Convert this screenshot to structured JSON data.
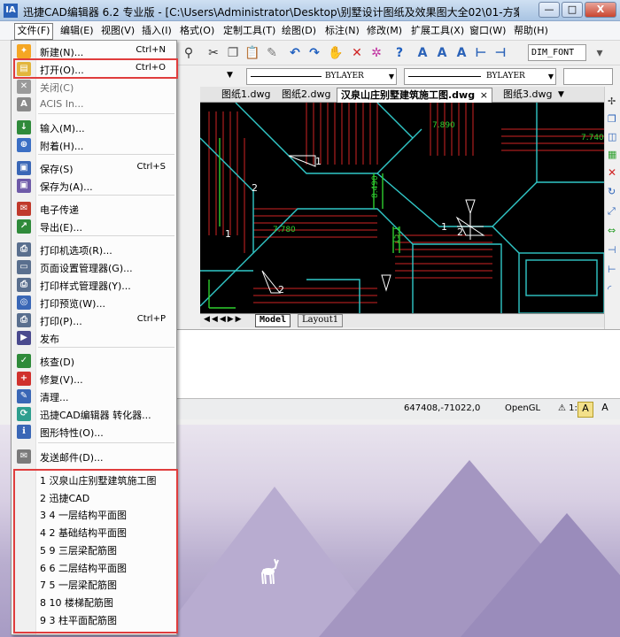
{
  "window": {
    "title": "迅捷CAD编辑器 6.2 专业版 - [C:\\Users\\Administrator\\Desktop\\别墅设计图纸及效果图大全02\\01-方案及施工图\\汉泉...",
    "logo": "IA",
    "minimize": "—",
    "maximize": "□",
    "close": "X"
  },
  "menubar": {
    "items": [
      "文件(F)",
      "编辑(E)",
      "视图(V)",
      "插入(I)",
      "格式(O)",
      "定制工具(T)",
      "绘图(D)",
      "标注(N)",
      "修改(M)",
      "扩展工具(X)",
      "窗口(W)",
      "帮助(H)"
    ]
  },
  "toolbar": {
    "dim_font": "DIM_FONT",
    "linetype": "BYLAYER",
    "lineweight": "BYLAYER"
  },
  "drawing_tabs": [
    "图纸1.dwg",
    "图纸2.dwg",
    "汉泉山庄别墅建筑施工图.dwg",
    "图纸3.dwg"
  ],
  "active_tab_close": "×",
  "layout_tabs": {
    "model": "Model",
    "layout1": "Layout1"
  },
  "status": {
    "coords": "647408,-71022,0",
    "render": "OpenGL",
    "scale": "1:1"
  },
  "file_menu": {
    "items": [
      {
        "label": "新建(N)...",
        "shortcut": "Ctrl+N",
        "icon": "new-file-icon",
        "color": "#f5a623",
        "disabled": false
      },
      {
        "label": "打开(O)...",
        "shortcut": "Ctrl+O",
        "icon": "open-folder-icon",
        "color": "#e2b53d",
        "disabled": false
      },
      {
        "label": "关闭(C)",
        "shortcut": "",
        "icon": "close-doc-icon",
        "color": "#9a9a9a",
        "disabled": true
      },
      {
        "label": "ACIS In...",
        "shortcut": "",
        "icon": "acis-icon",
        "color": "#8a8a8a",
        "disabled": true
      },
      {
        "label": "输入(M)...",
        "shortcut": "",
        "icon": "import-icon",
        "color": "#2f8a3a",
        "disabled": false
      },
      {
        "label": "附着(H)...",
        "shortcut": "",
        "icon": "attach-icon",
        "color": "#3b6fc4",
        "disabled": false
      },
      {
        "label": "保存(S)",
        "shortcut": "Ctrl+S",
        "icon": "save-icon",
        "color": "#3a67b6",
        "disabled": false
      },
      {
        "label": "保存为(A)...",
        "shortcut": "",
        "icon": "save-as-icon",
        "color": "#6e5aa8",
        "disabled": false
      },
      {
        "label": "电子传递",
        "shortcut": "",
        "icon": "etransmit-icon",
        "color": "#c0392b",
        "disabled": false
      },
      {
        "label": "导出(E)...",
        "shortcut": "",
        "icon": "export-icon",
        "color": "#2f8a3a",
        "disabled": false
      },
      {
        "label": "打印机选项(R)...",
        "shortcut": "",
        "icon": "printer-options-icon",
        "color": "#5a6f8e",
        "disabled": false
      },
      {
        "label": "页面设置管理器(G)...",
        "shortcut": "",
        "icon": "page-setup-icon",
        "color": "#5a6f8e",
        "disabled": false
      },
      {
        "label": "打印样式管理器(Y)...",
        "shortcut": "",
        "icon": "plot-style-icon",
        "color": "#5a6f8e",
        "disabled": false
      },
      {
        "label": "打印预览(W)...",
        "shortcut": "",
        "icon": "print-preview-icon",
        "color": "#3a67b6",
        "disabled": false
      },
      {
        "label": "打印(P)...",
        "shortcut": "Ctrl+P",
        "icon": "print-icon",
        "color": "#5a6f8e",
        "disabled": false
      },
      {
        "label": "发布",
        "shortcut": "",
        "icon": "publish-icon",
        "color": "#4a4a8e",
        "disabled": false
      },
      {
        "label": "核查(D)",
        "shortcut": "",
        "icon": "audit-icon",
        "color": "#2f8a3a",
        "disabled": false
      },
      {
        "label": "修复(V)...",
        "shortcut": "",
        "icon": "recover-icon",
        "color": "#d0312d",
        "disabled": false
      },
      {
        "label": "清理...",
        "shortcut": "",
        "icon": "purge-icon",
        "color": "#3a67b6",
        "disabled": false
      },
      {
        "label": "迅捷CAD编辑器 转化器...",
        "shortcut": "",
        "icon": "converter-icon",
        "color": "#2e9e8e",
        "disabled": false
      },
      {
        "label": "图形特性(O)...",
        "shortcut": "",
        "icon": "drawing-properties-icon",
        "color": "#3a67b6",
        "disabled": false
      },
      {
        "label": "发送邮件(D)...",
        "shortcut": "",
        "icon": "send-mail-icon",
        "color": "#7a7a7a",
        "disabled": false
      }
    ],
    "recent": [
      "1 汉泉山庄别墅建筑施工图",
      "2 迅捷CAD",
      "3 4 一层结构平面图",
      "4 2 基础结构平面图",
      "5 9 三层梁配筋图",
      "6 6 二层结构平面图",
      "7 5 一层梁配筋图",
      "8 10 楼梯配筋图",
      "9 3 柱平面配筋图"
    ]
  },
  "drawing_labels": {
    "a": "1",
    "b": "2",
    "c": "1",
    "d": "2",
    "e": "1",
    "f": "2",
    "g": "7.890",
    "h": "7.740",
    "i": "7.780",
    "j": "8.490",
    "k": "15.1",
    "l": "1"
  },
  "colors": {
    "highlight": "#e03d3d",
    "canvas": "#000000",
    "line_red": "#d02424",
    "line_cyan": "#31c8c8",
    "line_green": "#2fcf2f"
  }
}
